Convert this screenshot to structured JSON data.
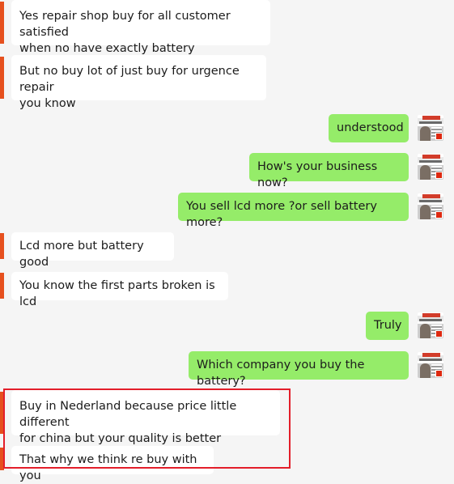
{
  "messages": [
    {
      "id": "m1",
      "side": "in",
      "text": "Yes repair shop buy for all customer satisfied\nwhen no have exactly battery"
    },
    {
      "id": "m2",
      "side": "in",
      "text": "But no buy lot of just buy for urgence repair\nyou know"
    },
    {
      "id": "m3",
      "side": "out",
      "text": "understood"
    },
    {
      "id": "m4",
      "side": "out",
      "text": "How's your business now?"
    },
    {
      "id": "m5",
      "side": "out",
      "text": "You sell lcd more ?or sell battery more?"
    },
    {
      "id": "m6",
      "side": "in",
      "text": "Lcd more but battery good"
    },
    {
      "id": "m7",
      "side": "in",
      "text": "You know the first parts broken is lcd"
    },
    {
      "id": "m8",
      "side": "out",
      "text": "Truly"
    },
    {
      "id": "m9",
      "side": "out",
      "text": "Which company you buy the battery?"
    },
    {
      "id": "m10",
      "side": "in",
      "text": "Buy in Nederland  because price little different\nfor china  but your quality is better"
    },
    {
      "id": "m11",
      "side": "in",
      "text": "That why we think re buy with you"
    }
  ],
  "colors": {
    "background": "#f5f5f5",
    "incoming_bubble": "#ffffff",
    "outgoing_bubble": "#95ec69",
    "incoming_accent": "#e6501e",
    "highlight_border": "#e31e2a"
  },
  "avatar": {
    "icon": "shop-avatar-icon",
    "badge": "china-flag-icon"
  }
}
